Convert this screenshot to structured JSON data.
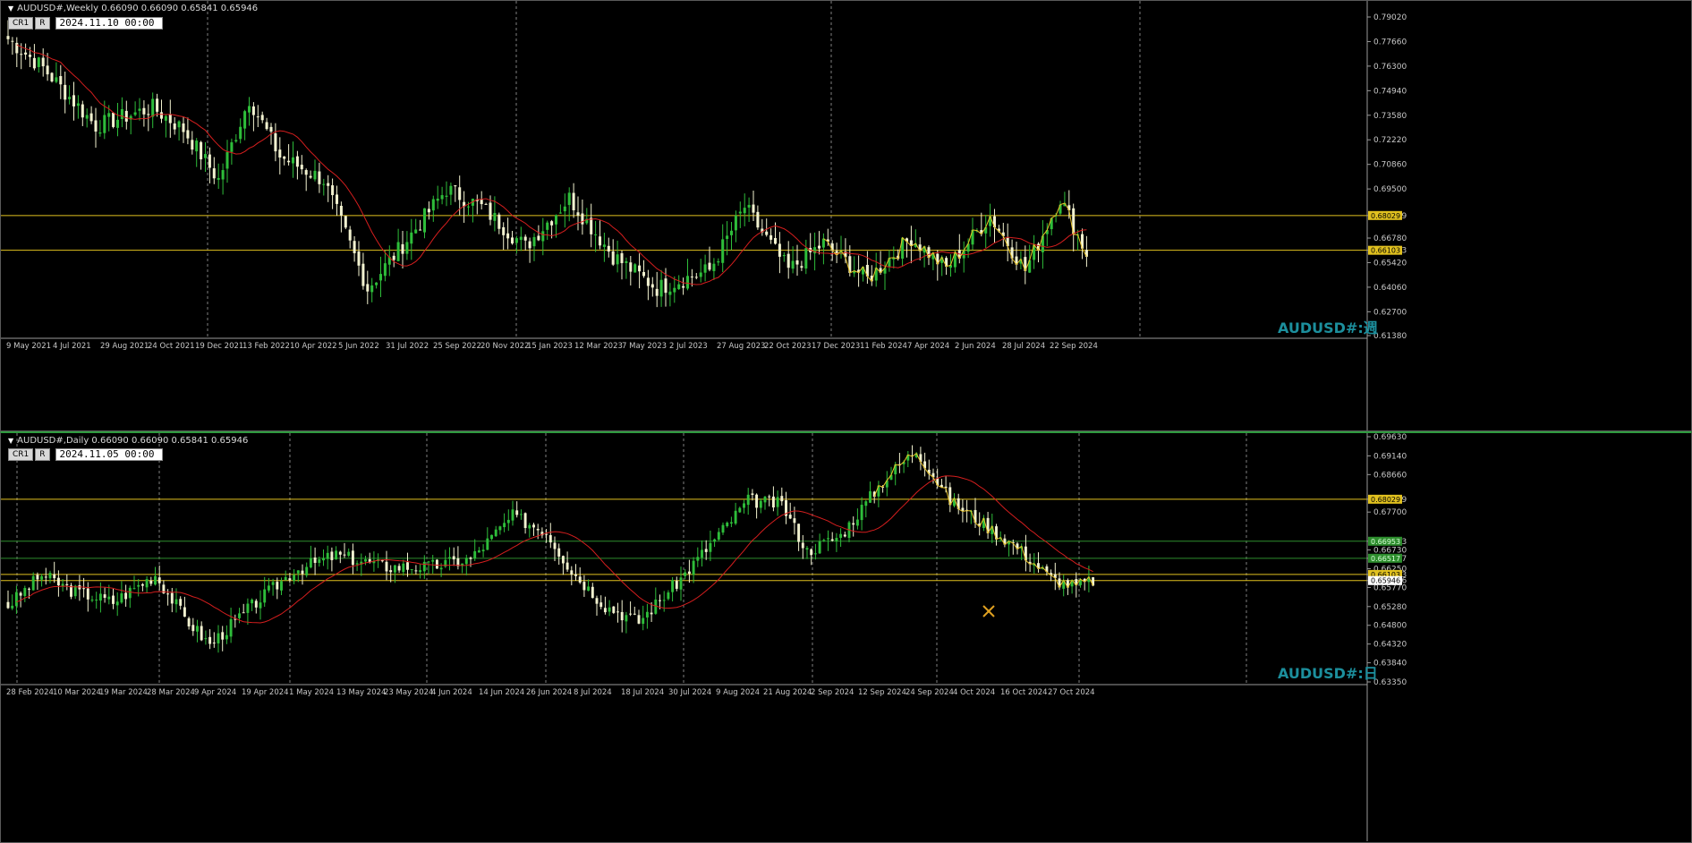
{
  "colors": {
    "background": "#000000",
    "bull": "#2ebd3a",
    "bear": "#f2f2d0",
    "ma": "#d51e1e",
    "zigzag": "#e6c228",
    "level": "#e1c11f",
    "green_level": "#2d8d2d",
    "grid": "#808080",
    "watermark": "#1c8f9d"
  },
  "weekly": {
    "header": "AUDUSD#,Weekly  0.66090 0.66090 0.65841 0.65946",
    "tag_cr1": "CR1",
    "tag_r": "R",
    "date_box": "2024.11.10 00:00",
    "watermark": "AUDUSD#:週",
    "price_ticks": [
      "0.79020",
      "0.77660",
      "0.76300",
      "0.74940",
      "0.73580",
      "0.72220",
      "0.70860",
      "0.69500",
      "0.68029",
      "0.66780",
      "0.66103",
      "0.65420",
      "0.64060",
      "0.62700",
      "0.61380"
    ],
    "level_labels": [
      "0.68029",
      "0.66103"
    ],
    "time_labels": [
      "9 May 2021",
      "4 Jul 2021",
      "29 Aug 2021",
      "24 Oct 2021",
      "19 Dec 2021",
      "13 Feb 2022",
      "10 Apr 2022",
      "5 Jun 2022",
      "31 Jul 2022",
      "25 Sep 2022",
      "20 Nov 2022",
      "15 Jan 2023",
      "12 Mar 2023",
      "7 May 2023",
      "2 Jul 2023",
      "27 Aug 2023",
      "22 Oct 2023",
      "17 Dec 2023",
      "11 Feb 2024",
      "7 Apr 2024",
      "2 Jun 2024",
      "28 Jul 2024",
      "22 Sep 2024"
    ]
  },
  "daily": {
    "header": "AUDUSD#,Daily  0.66090 0.66090 0.65841 0.65946",
    "tag_cr1": "CR1",
    "tag_r": "R",
    "date_box": "2024.11.05 00:00",
    "watermark": "AUDUSD#:日",
    "price_ticks": [
      "0.69630",
      "0.69140",
      "0.68660",
      "0.68029",
      "0.67700",
      "0.66953",
      "0.66730",
      "0.66517",
      "0.66250",
      "0.66103",
      "0.65946",
      "0.65770",
      "0.65280",
      "0.64800",
      "0.64320",
      "0.63840",
      "0.63350"
    ],
    "level_labels": [
      "0.68029",
      "0.66953",
      "0.66517",
      "0.66103",
      "0.65946"
    ],
    "time_labels": [
      "28 Feb 2024",
      "10 Mar 2024",
      "19 Mar 2024",
      "28 Mar 2024",
      "9 Apr 2024",
      "19 Apr 2024",
      "1 May 2024",
      "13 May 2024",
      "23 May 2024",
      "4 Jun 2024",
      "14 Jun 2024",
      "26 Jun 2024",
      "8 Jul 2024",
      "18 Jul 2024",
      "30 Jul 2024",
      "9 Aug 2024",
      "21 Aug 2024",
      "2 Sep 2024",
      "12 Sep 2024",
      "24 Sep 2024",
      "4 Oct 2024",
      "16 Oct 2024",
      "27 Oct 2024"
    ]
  }
}
